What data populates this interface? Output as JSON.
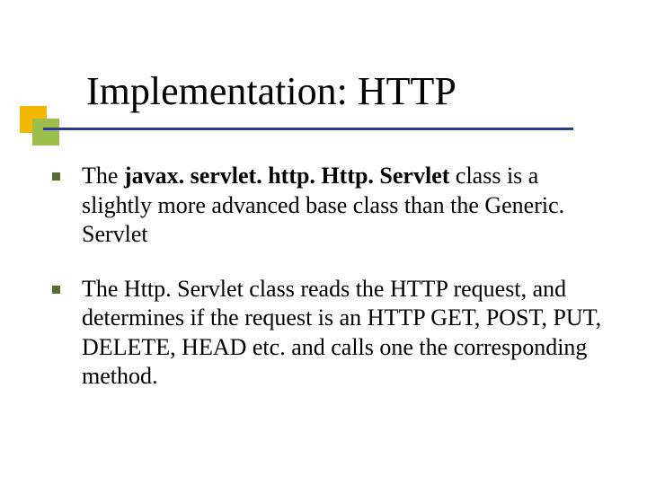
{
  "slide": {
    "title": "Implementation: HTTP",
    "bullets": [
      {
        "pre": "The ",
        "bold": "javax. servlet. http. Http. Servlet",
        "post": " class is a slightly more advanced base class than the Generic. Servlet"
      },
      {
        "pre": "",
        "bold": "",
        "post": "The Http. Servlet class reads the HTTP  request, and determines if the request is an  HTTP GET, POST, PUT, DELETE, HEAD etc. and calls one the corresponding method."
      }
    ]
  }
}
